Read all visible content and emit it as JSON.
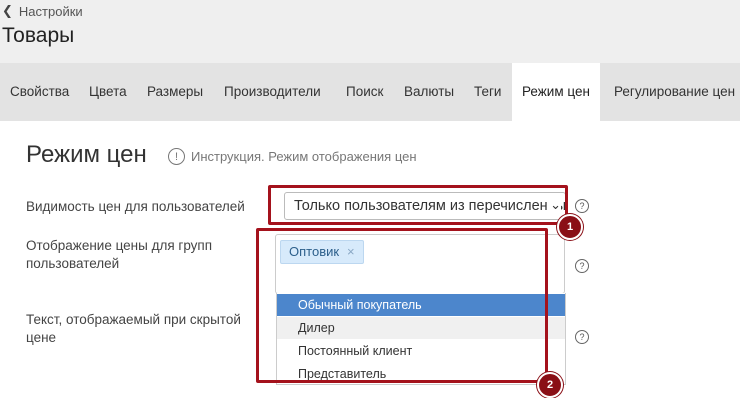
{
  "header": {
    "back_label": "Настройки",
    "title": "Товары"
  },
  "tabs": [
    {
      "label": "Свойства"
    },
    {
      "label": "Цвета"
    },
    {
      "label": "Размеры"
    },
    {
      "label": "Производители"
    },
    {
      "label": "Поиск"
    },
    {
      "label": "Валюты"
    },
    {
      "label": "Теги"
    },
    {
      "label": "Режим цен",
      "active": true
    },
    {
      "label": "Регулирование цен"
    }
  ],
  "section": {
    "title": "Режим цен",
    "help_link": "Инструкция. Режим отображения цен"
  },
  "fields": {
    "visibility": {
      "label": "Видимость цен для пользователей",
      "value": "Только пользователям из перечисленных групп"
    },
    "groups": {
      "label": "Отображение цены для групп пользователей",
      "selected_chip": "Оптовик",
      "chip_remove": "×",
      "options": [
        "Обычный покупатель",
        "Дилер",
        "Постоянный клиент",
        "Представитель"
      ],
      "highlighted_index": 0
    },
    "hidden_text": {
      "label": "Текст, отображаемый при скрытой цене"
    }
  },
  "annotations": {
    "badge_1": "1",
    "badge_2": "2",
    "color": "#a4121c"
  },
  "icons": {
    "back": "chevron-left-icon",
    "help": "comment-icon",
    "question": "question-circle-icon"
  }
}
